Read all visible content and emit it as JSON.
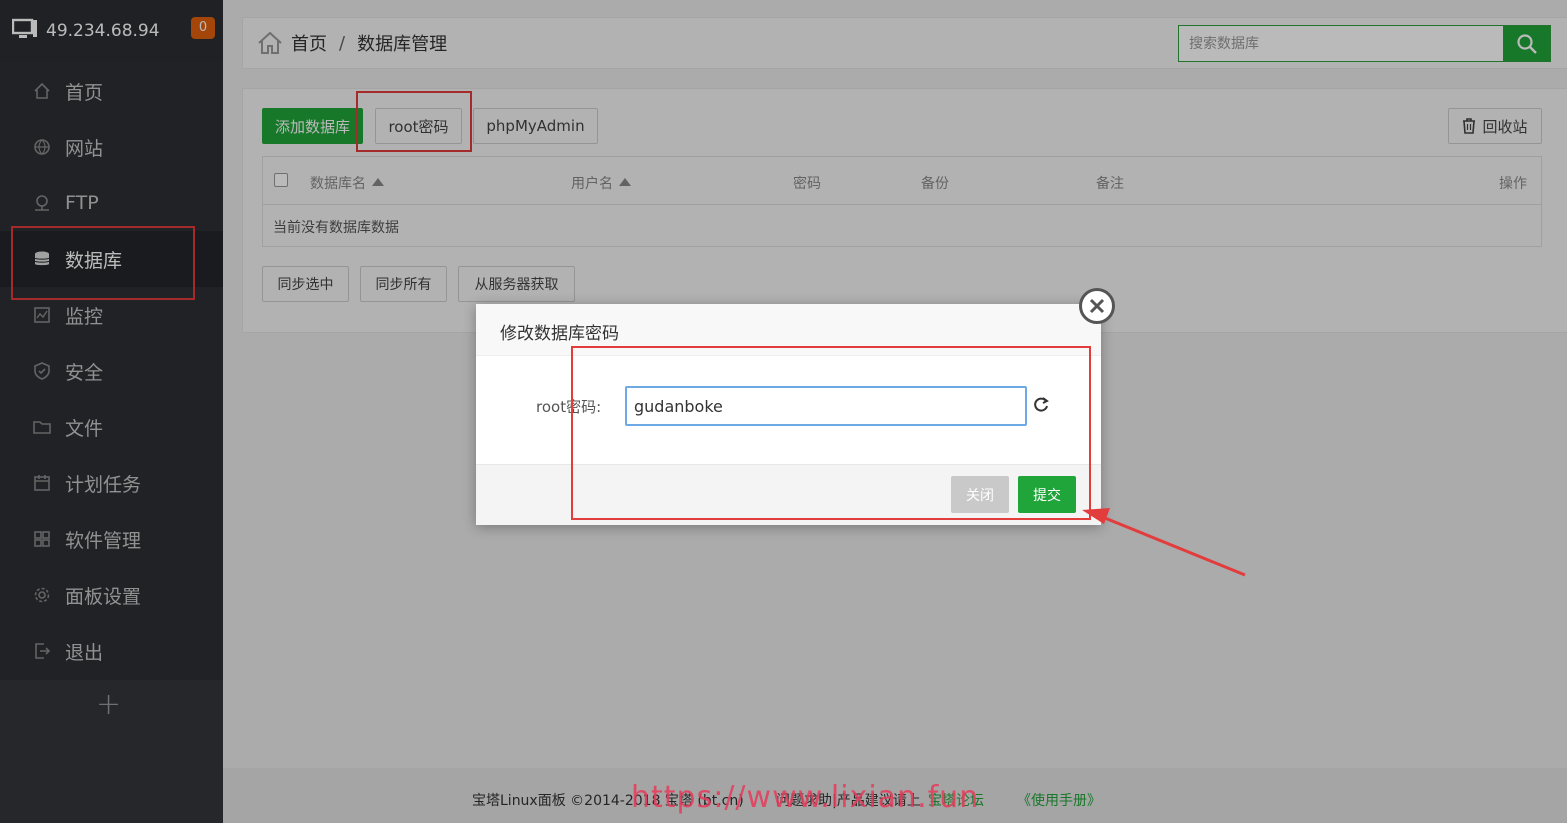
{
  "header": {
    "ip": "49.234.68.94",
    "notification_count": "0"
  },
  "sidebar": {
    "items": [
      {
        "label": "首页",
        "icon": "home-icon"
      },
      {
        "label": "网站",
        "icon": "globe-icon"
      },
      {
        "label": "FTP",
        "icon": "ftp-icon"
      },
      {
        "label": "数据库",
        "icon": "database-icon",
        "active": true
      },
      {
        "label": "监控",
        "icon": "monitor-icon"
      },
      {
        "label": "安全",
        "icon": "shield-icon"
      },
      {
        "label": "文件",
        "icon": "folder-icon"
      },
      {
        "label": "计划任务",
        "icon": "calendar-icon"
      },
      {
        "label": "软件管理",
        "icon": "grid-icon"
      },
      {
        "label": "面板设置",
        "icon": "gear-icon"
      },
      {
        "label": "退出",
        "icon": "logout-icon"
      }
    ],
    "add_label": "+"
  },
  "breadcrumb": {
    "home": "首页",
    "separator": "/",
    "current": "数据库管理"
  },
  "search": {
    "placeholder": "搜索数据库"
  },
  "toolbar": {
    "add_db": "添加数据库",
    "root_password": "root密码",
    "phpmyadmin": "phpMyAdmin",
    "recycle_bin": "回收站"
  },
  "table": {
    "columns": [
      "数据库名",
      "用户名",
      "密码",
      "备份",
      "备注",
      "操作"
    ],
    "empty_message": "当前没有数据库数据"
  },
  "actions": {
    "sync_selected": "同步选中",
    "sync_all": "同步所有",
    "fetch_from_server": "从服务器获取"
  },
  "modal": {
    "title": "修改数据库密码",
    "field_label": "root密码:",
    "field_value": "gudanboke",
    "close_button": "关闭",
    "submit_button": "提交"
  },
  "footer": {
    "copyright": "宝塔Linux面板 ©2014-2018 宝塔 (bt.cn)",
    "feedback": "问题求助|产品建议请上",
    "forum": "宝塔论坛",
    "manual": "《使用手册》"
  },
  "watermark": "https://www.lixian.fun",
  "colors": {
    "accent_green": "#20a53a",
    "annotation_red": "#e23c3c",
    "badge_orange": "#e15f0e"
  }
}
